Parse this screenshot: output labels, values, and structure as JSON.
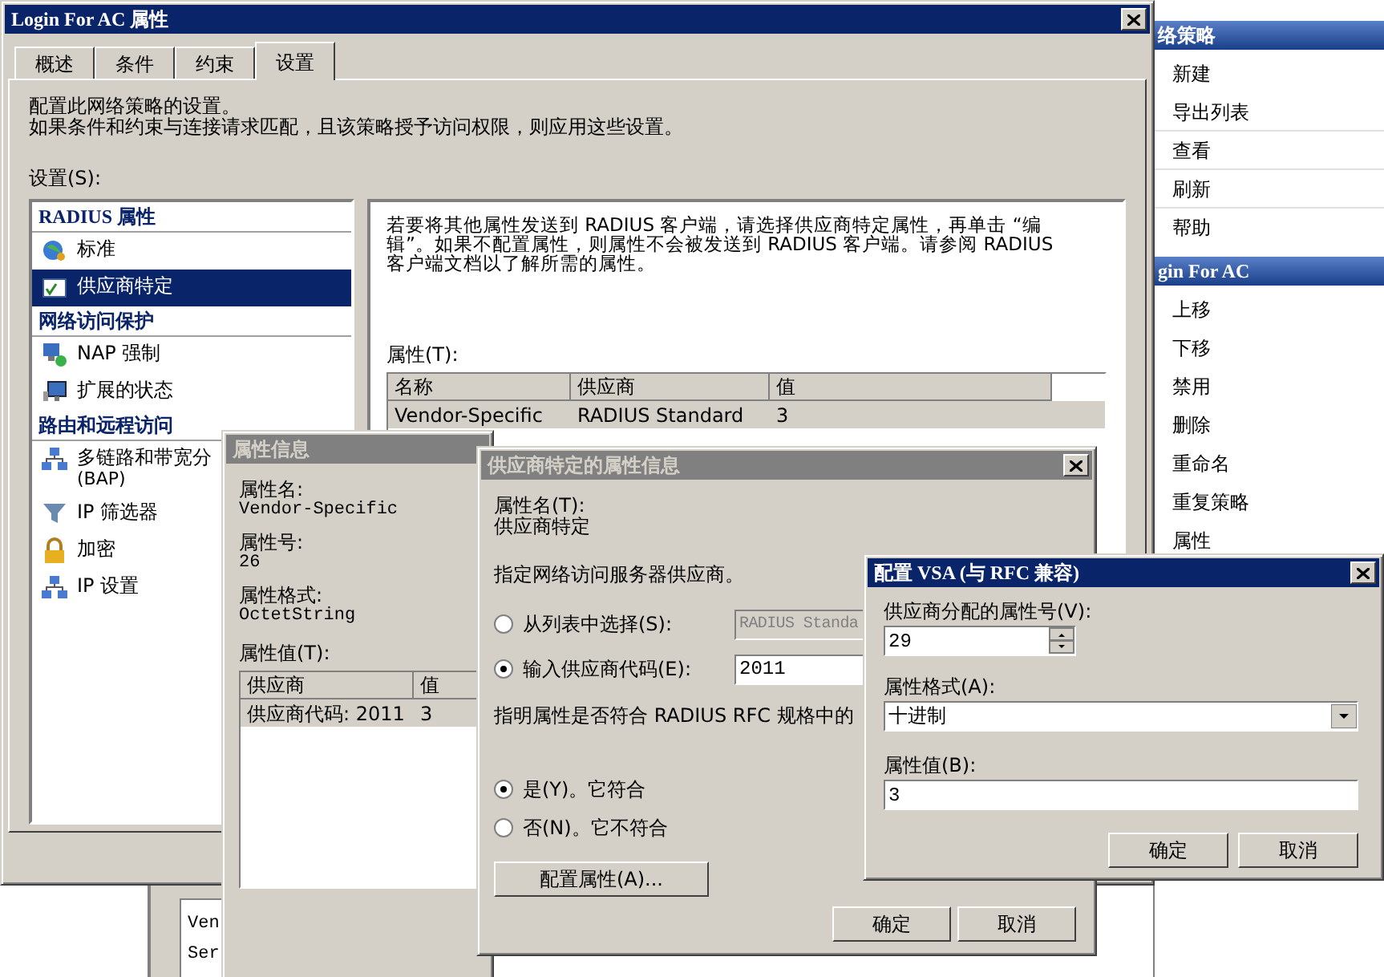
{
  "main_window": {
    "title": "Login For AC 属性",
    "tabs": [
      {
        "label": "概述",
        "selected": false
      },
      {
        "label": "条件",
        "selected": false
      },
      {
        "label": "约束",
        "selected": false
      },
      {
        "label": "设置",
        "selected": true
      }
    ],
    "intro": [
      "配置此网络策略的设置。",
      "如果条件和约束与连接请求匹配，且该策略授予访问权限，则应用这些设置。"
    ],
    "settings_label": "设置(S):",
    "settings_groups": [
      {
        "title": "RADIUS 属性",
        "items": [
          {
            "label": "标准",
            "selected": false
          },
          {
            "label": "供应商特定",
            "selected": true
          }
        ]
      },
      {
        "title": "网络访问保护",
        "items": [
          {
            "label": "NAP 强制",
            "selected": false
          },
          {
            "label": "扩展的状态",
            "selected": false
          }
        ]
      },
      {
        "title": "路由和远程访问",
        "items": [
          {
            "label": "多链路和带宽分",
            "sublabel": "(BAP)",
            "selected": false
          },
          {
            "label": "IP 筛选器",
            "selected": false
          },
          {
            "label": "加密",
            "selected": false
          },
          {
            "label": "IP 设置",
            "selected": false
          }
        ]
      }
    ],
    "description": "若要将其他属性发送到 RADIUS 客户端，请选择供应商特定属性，再单击 “编辑”。如果不配置属性，则属性不会被发送到 RADIUS 客户端。请参阅 RADIUS 客户端文档以了解所需的属性。",
    "attributes_label": "属性(T):",
    "attributes_table": {
      "columns": [
        "名称",
        "供应商",
        "值"
      ],
      "rows": [
        {
          "cells": [
            "Vendor-Specific",
            "RADIUS Standard",
            "3"
          ],
          "selected": true
        }
      ]
    }
  },
  "actions_pane": {
    "sections": [
      {
        "title": "络策略",
        "items": [
          "新建",
          "导出列表",
          "查看",
          "刷新",
          "帮助"
        ]
      },
      {
        "title": "gin For AC",
        "items": [
          "上移",
          "下移",
          "禁用",
          "删除",
          "重命名",
          "重复策略",
          "属性"
        ]
      }
    ]
  },
  "background_window": {
    "lines": [
      "Ven",
      "Ser"
    ]
  },
  "attribute_info_window": {
    "title": "属性信息",
    "fields": [
      {
        "label": "属性名:",
        "value": "Vendor-Specific"
      },
      {
        "label": "属性号:",
        "value": "26"
      },
      {
        "label": "属性格式:",
        "value": "OctetString"
      }
    ],
    "values_label": "属性值(T):",
    "values_table": {
      "columns": [
        "供应商",
        "值"
      ],
      "rows": [
        {
          "cells": [
            "供应商代码: 2011",
            "3"
          ],
          "selected": true
        }
      ]
    }
  },
  "vendor_window": {
    "title": "供应商特定的属性信息",
    "name_label": "属性名(T):",
    "name_value": "供应商特定",
    "vendor_prompt": "指定网络访问服务器供应商。",
    "vendor_options": [
      {
        "label": "从列表中选择(S):",
        "selected": false,
        "field": "RADIUS Standa",
        "disabled": true
      },
      {
        "label": "输入供应商代码(E):",
        "selected": true,
        "field": "2011",
        "disabled": false
      }
    ],
    "compliance_prompt": "指明属性是否符合 RADIUS RFC 规格中的",
    "compliance_options": [
      {
        "label": "是(Y)。它符合",
        "selected": true
      },
      {
        "label": "否(N)。它不符合",
        "selected": false
      }
    ],
    "configure_button": "配置属性(A)...",
    "buttons": [
      "确定",
      "取消"
    ]
  },
  "vsa_window": {
    "title": "配置 VSA (与 RFC 兼容)",
    "number_label": "供应商分配的属性号(V):",
    "number_value": "29",
    "format_label": "属性格式(A):",
    "format_value": "十进制",
    "value_label": "属性值(B):",
    "value_value": "3",
    "buttons": [
      "确定",
      "取消"
    ]
  }
}
